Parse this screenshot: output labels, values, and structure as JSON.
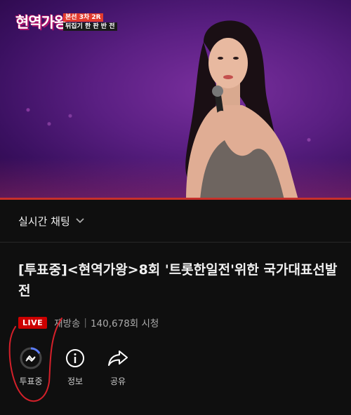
{
  "video": {
    "logo_text": "현역가왕",
    "episode_line1": "본선 3차 2R",
    "episode_line2": "뒤집기 한 판 반 전"
  },
  "chat": {
    "label": "실시간 채팅"
  },
  "video_title": "[투표중]<현역가왕>8회 '트롯한일전'위한 국가대표선발전",
  "meta": {
    "live": "LIVE",
    "rebroadcast": "재방송",
    "separator": "|",
    "views": "140,678회 시청"
  },
  "actions": [
    {
      "label": "투표중",
      "icon": "vote-icon"
    },
    {
      "label": "정보",
      "icon": "info-icon"
    },
    {
      "label": "공유",
      "icon": "share-icon"
    }
  ],
  "colors": {
    "background": "#0f0f0f",
    "live_badge": "#cc0000",
    "annotation": "#d4202a",
    "stage_purple": "#5a1f82"
  }
}
